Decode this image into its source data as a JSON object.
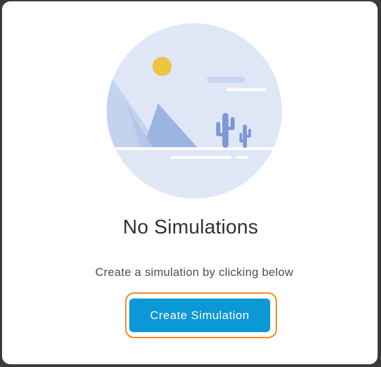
{
  "empty_state": {
    "illustration_icon": "desert-landscape-illustration",
    "title": "No Simulations",
    "subtitle": "Create a simulation by clicking below",
    "button_label": "Create Simulation"
  },
  "colors": {
    "button_bg": "#0c97d5",
    "focus_ring": "#f28c1f",
    "illustration_bg": "#dfe7f7",
    "sun": "#edc542",
    "mountain_light": "#c3d3ee",
    "mountain_dark": "#9cb4e1",
    "cactus": "#7c98d6"
  }
}
